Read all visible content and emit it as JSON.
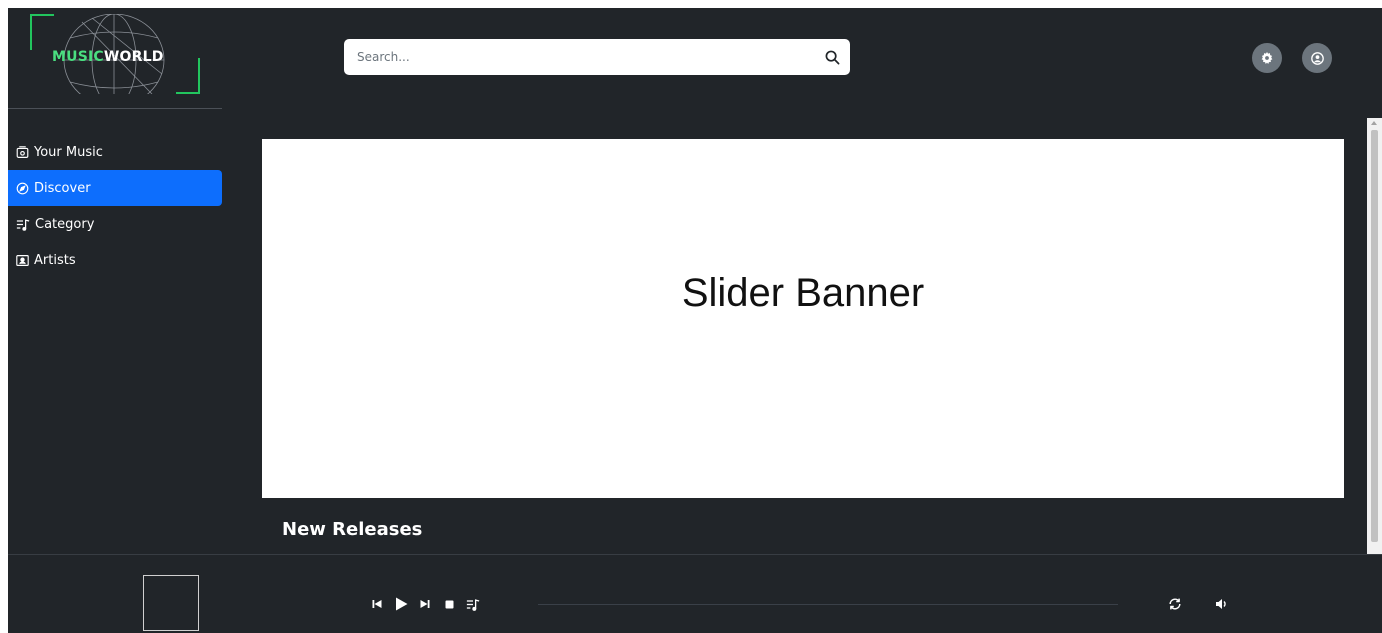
{
  "brand": {
    "part1": "MUSIC",
    "part2": "WORLD"
  },
  "search": {
    "placeholder": "Search..."
  },
  "sidebar": {
    "items": [
      {
        "label": "Your Music",
        "icon": "music-box-icon",
        "active": false
      },
      {
        "label": "Discover",
        "icon": "compass-icon",
        "active": true
      },
      {
        "label": "Category",
        "icon": "playlist-icon",
        "active": false
      },
      {
        "label": "Artists",
        "icon": "contact-card-icon",
        "active": false
      }
    ]
  },
  "header": {
    "settings_icon": "gear-icon",
    "account_icon": "user-circle-icon"
  },
  "banner": {
    "title": "Slider Banner"
  },
  "main": {
    "section_title": "New Releases"
  },
  "player": {
    "controls": [
      "previous-icon",
      "play-icon",
      "next-icon",
      "stop-icon",
      "playlist-icon"
    ],
    "progress": 0,
    "right_controls": [
      "repeat-icon",
      "volume-icon"
    ]
  },
  "colors": {
    "background": "#212529",
    "accent": "#0d6efd",
    "brand_green": "#4ade80",
    "icon_button": "#6c757d"
  }
}
